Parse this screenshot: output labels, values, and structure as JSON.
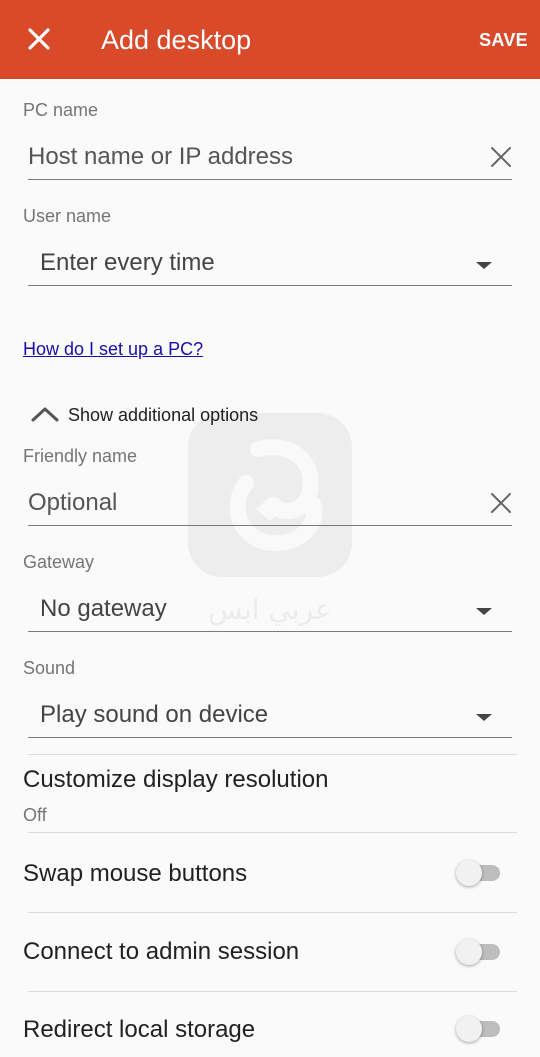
{
  "appbar": {
    "title": "Add desktop",
    "save_label": "SAVE",
    "close_icon": "close-icon",
    "background": "#d84a2a"
  },
  "pc_name": {
    "label": "PC name",
    "placeholder": "Host name or IP address",
    "clear_icon": "clear-icon"
  },
  "user_name": {
    "label": "User name",
    "selected": "Enter every time",
    "icon": "dropdown-arrow-icon"
  },
  "help_link": "How do I set up a PC?",
  "additional_options": {
    "label": "Show additional options",
    "icon": "chevron-up-icon"
  },
  "friendly_name": {
    "label": "Friendly name",
    "placeholder": "Optional",
    "clear_icon": "clear-icon"
  },
  "gateway": {
    "label": "Gateway",
    "selected": "No gateway",
    "icon": "dropdown-arrow-icon"
  },
  "sound": {
    "label": "Sound",
    "selected": "Play sound on device",
    "icon": "dropdown-arrow-icon"
  },
  "display_resolution": {
    "title": "Customize display resolution",
    "value": "Off"
  },
  "toggles": [
    {
      "label": "Swap mouse buttons",
      "on": false
    },
    {
      "label": "Connect to admin session",
      "on": false
    },
    {
      "label": "Redirect local storage",
      "on": false
    }
  ],
  "watermark": {
    "text": "عربي ابس"
  }
}
